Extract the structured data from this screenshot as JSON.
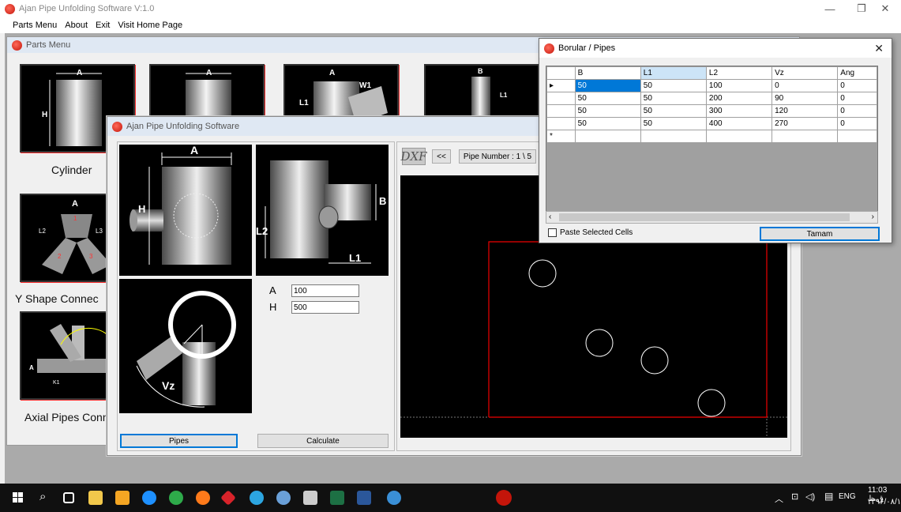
{
  "app": {
    "title": "Ajan Pipe Unfolding Software  V:1.0",
    "menu": [
      "Parts Menu",
      "About",
      "Exit",
      "Visit Home Page"
    ]
  },
  "parts_window": {
    "title": "Parts Menu",
    "tiles": [
      "Cylinder",
      "Y Shape Connec",
      "Axial Pipes Conne"
    ]
  },
  "calc_window": {
    "title": "Ajan Pipe Unfolding Software",
    "fields": [
      {
        "label": "A",
        "value": "100"
      },
      {
        "label": "H",
        "value": "500"
      }
    ],
    "pipes_button": "Pipes",
    "calculate_button": "Calculate",
    "dxf_label": "DXF",
    "prev_button": "<<",
    "pipe_number": "Pipe Number : 1 \\ 5",
    "diagram_labels": {
      "a": "A",
      "h": "H",
      "b": "B",
      "l1": "L1",
      "l2": "L2",
      "vz": "Vz"
    }
  },
  "pipes_window": {
    "title": "Borular / Pipes",
    "columns": [
      "B",
      "L1",
      "L2",
      "Vz",
      "Ang"
    ],
    "rows": [
      [
        "50",
        "50",
        "100",
        "0",
        "0"
      ],
      [
        "50",
        "50",
        "200",
        "90",
        "0"
      ],
      [
        "50",
        "50",
        "300",
        "120",
        "0"
      ],
      [
        "50",
        "50",
        "400",
        "270",
        "0"
      ]
    ],
    "new_row_marker": "*",
    "current_row_marker": "▸",
    "paste_label": "Paste Selected Cells",
    "ok_button": "Tamam"
  },
  "taskbar": {
    "tray_lang": "ENG",
    "tray_time": "11:03 ق.ظ",
    "tray_date": "۱۳۹۶/۰۸/۱۶"
  },
  "colors": {
    "accent": "#0078d7",
    "outline": "#ff0000"
  }
}
